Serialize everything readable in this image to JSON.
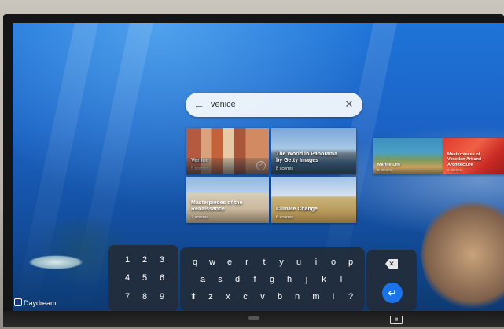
{
  "search": {
    "query": "venice"
  },
  "results": [
    {
      "title": "Venice",
      "sub": "5 scenes"
    },
    {
      "title": "The World in Panorama by Getty Images",
      "sub": "8 scenes"
    },
    {
      "title": "Masterpieces of the Renaissance",
      "sub": "7 scenes"
    },
    {
      "title": "Climate Change",
      "sub": "6 scenes"
    },
    {
      "title": "Marine Life",
      "sub": "8 scenes"
    },
    {
      "title": "Masterpieces of Venetian Art and Architecture",
      "sub": "6 scenes"
    }
  ],
  "keyboard": {
    "numpad": [
      "1",
      "2",
      "3",
      "4",
      "5",
      "6",
      "7",
      "8",
      "9"
    ],
    "row1": [
      "q",
      "w",
      "e",
      "r",
      "t",
      "y",
      "u",
      "i",
      "o",
      "p"
    ],
    "row2": [
      "a",
      "s",
      "d",
      "f",
      "g",
      "h",
      "j",
      "k",
      "l"
    ],
    "row3": [
      "z",
      "x",
      "c",
      "v",
      "b",
      "n",
      "m",
      "!",
      "?"
    ],
    "shift": "⬆",
    "backspace": "✕",
    "enter": "↵"
  },
  "branding": {
    "daydream": "Daydream"
  },
  "colors": {
    "accent": "#1a73e8"
  }
}
